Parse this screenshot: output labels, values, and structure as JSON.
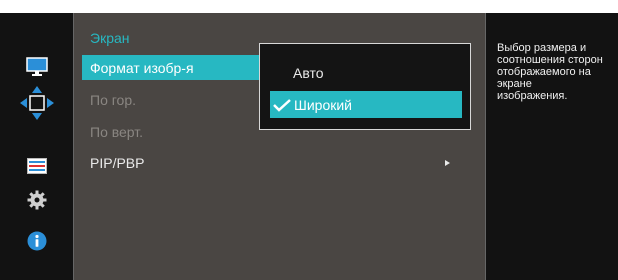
{
  "menu": {
    "items": [
      {
        "label": "Экран",
        "state": "header"
      },
      {
        "label": "Формат изобр-я",
        "state": "selected"
      },
      {
        "label": "По гор.",
        "state": "disabled"
      },
      {
        "label": "По верт.",
        "state": "disabled"
      },
      {
        "label": "PIP/PBP",
        "state": "normal",
        "has_submenu": true
      }
    ]
  },
  "submenu": {
    "items": [
      {
        "label": "Авто",
        "selected": false
      },
      {
        "label": "Широкий",
        "selected": true
      }
    ]
  },
  "description": {
    "text": "Выбор размера и\nсоотношения сторон\nотображаемого на\nэкране\nизображения."
  },
  "rail": {
    "icons": [
      "monitor-icon",
      "move-arrows-icon",
      "settings-sliders-icon",
      "gear-icon",
      "info-icon"
    ]
  },
  "colors": {
    "accent": "#27b8c2",
    "menu_bg": "#4a4643",
    "background": "#121212"
  }
}
